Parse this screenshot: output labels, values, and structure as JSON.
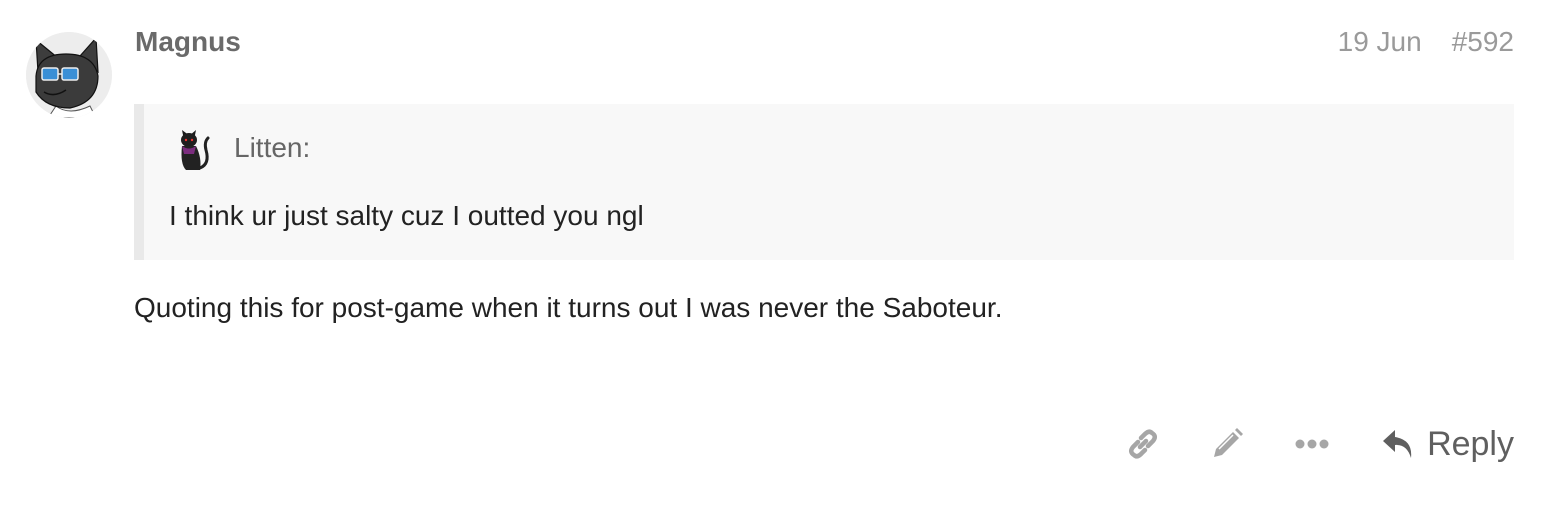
{
  "post": {
    "username": "Magnus",
    "date": "19 Jun",
    "post_number": "#592",
    "quote": {
      "author": "Litten:",
      "text": "I think ur just salty cuz I outted you ngl"
    },
    "body": "Quoting this for post-game when it turns out I was never the Saboteur."
  },
  "actions": {
    "link_icon": "link-icon",
    "edit_icon": "pencil-icon",
    "more_icon": "ellipsis-icon",
    "reply_icon": "reply-arrow-icon",
    "reply_label": "Reply"
  },
  "colors": {
    "username": "#6a6a6a",
    "meta": "#9a9a9a",
    "quote_bg": "#f8f8f8",
    "quote_border": "#e9e9e9",
    "action_icons": "#a6a6a6",
    "reply": "#5f5f5f"
  }
}
